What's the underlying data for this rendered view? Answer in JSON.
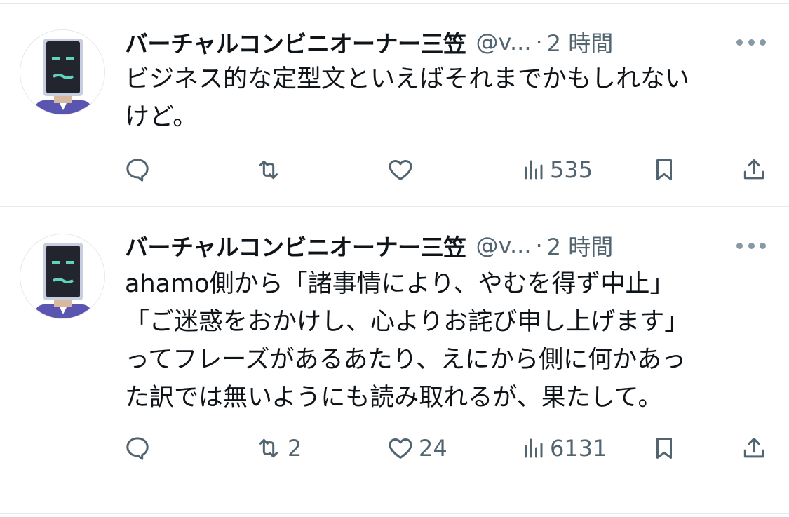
{
  "tweets": [
    {
      "author_name": "バーチャルコンビニオーナー三笠",
      "handle": "@v...",
      "separator": "·",
      "time": "2 時間",
      "lines": [
        "ビジネス的な定型文といえばそれまでかもしれない",
        "けど。"
      ],
      "actions": {
        "reply": {
          "icon": "reply-icon",
          "count": ""
        },
        "repost": {
          "icon": "repost-icon",
          "count": ""
        },
        "like": {
          "icon": "heart-icon",
          "count": ""
        },
        "views": {
          "icon": "views-chart-icon",
          "count": "535"
        },
        "bookmark": {
          "icon": "bookmark-icon"
        },
        "share": {
          "icon": "share-icon"
        }
      }
    },
    {
      "author_name": "バーチャルコンビニオーナー三笠",
      "handle": "@v...",
      "separator": "·",
      "time": "2 時間",
      "lines": [
        "ahamo側から「諸事情により、やむを得ず中止」",
        "「ご迷惑をおかけし、心よりお詫び申し上げます」",
        "ってフレーズがあるあたり、えにから側に何かあっ",
        "た訳では無いようにも読み取れるが、果たして。"
      ],
      "actions": {
        "reply": {
          "icon": "reply-icon",
          "count": ""
        },
        "repost": {
          "icon": "repost-icon",
          "count": "2"
        },
        "like": {
          "icon": "heart-icon",
          "count": "24"
        },
        "views": {
          "icon": "views-chart-icon",
          "count": "6131"
        },
        "bookmark": {
          "icon": "bookmark-icon"
        },
        "share": {
          "icon": "share-icon"
        }
      }
    }
  ],
  "colors": {
    "text": "#0f1419",
    "secondary": "#536471",
    "divider": "#e6e9ec",
    "avatar_teal": "#5fd3c0",
    "avatar_suit": "#5a55b0"
  }
}
